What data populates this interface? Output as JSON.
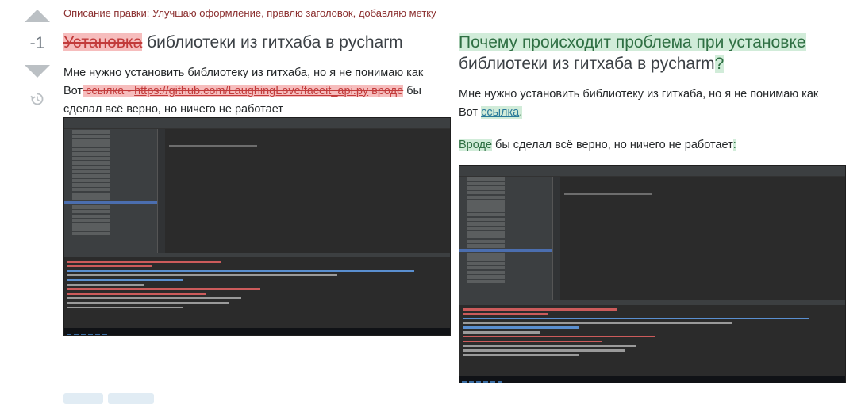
{
  "edit_summary": "Описание правки: Улучшаю оформление, правлю заголовок, добавляю метку",
  "vote": {
    "score": "-1",
    "up_icon": "arrow-up-icon",
    "down_icon": "arrow-down-icon",
    "history_icon": "history-icon"
  },
  "left": {
    "title_deleted": "Установка",
    "title_rest": " библиотеки из гитхаба в pycharm",
    "body_line1": "Мне нужно установить библиотеку из гитхаба, но я не понимаю как",
    "body_vot": "Вот",
    "body_del1": " ссылка - ",
    "body_del_link": "https://github.com/LaughingLove/faceit_api.py",
    "body_del2": " вроде",
    "body_tail": " бы сделал всё верно, но ничего не работает"
  },
  "right": {
    "title_ins": "Почему происходит проблема при установке",
    "title_rest": " библиотеки из гитхаба в pycharm",
    "title_qmark": "?",
    "body_line1": "Мне нужно установить библиотеку из гитхаба, но я не понимаю как",
    "body_vot": "Вот ",
    "body_ins_link": "ссылка",
    "body_ins_dot": ".",
    "body2_ins": "Вроде",
    "body2_rest": " бы сделал всё верно, но ничего не работает",
    "body2_colon": ":"
  },
  "colors": {
    "deleted_bg": "#f6bdbd",
    "inserted_bg": "#d1ecd9",
    "ide_bg": "#2b2b2b",
    "selection": "#4b6eaf"
  }
}
